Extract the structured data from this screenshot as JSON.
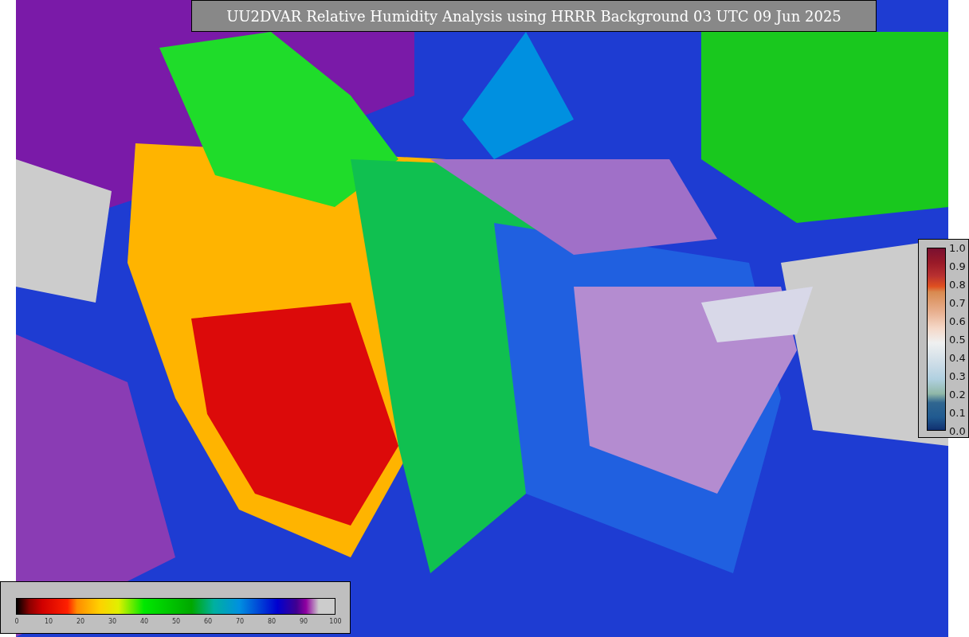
{
  "title": "UU2DVAR Relative Humidity Analysis using HRRR Background 03 UTC 09 Jun 2025",
  "humidity_colorbar": {
    "ticks": [
      "0",
      "10",
      "20",
      "30",
      "40",
      "50",
      "60",
      "70",
      "80",
      "90",
      "100"
    ]
  },
  "difference_colorbar": {
    "ticks": [
      "1.0",
      "0.9",
      "0.8",
      "0.7",
      "0.6",
      "0.5",
      "0.4",
      "0.3",
      "0.2",
      "0.1",
      "0.0"
    ]
  }
}
